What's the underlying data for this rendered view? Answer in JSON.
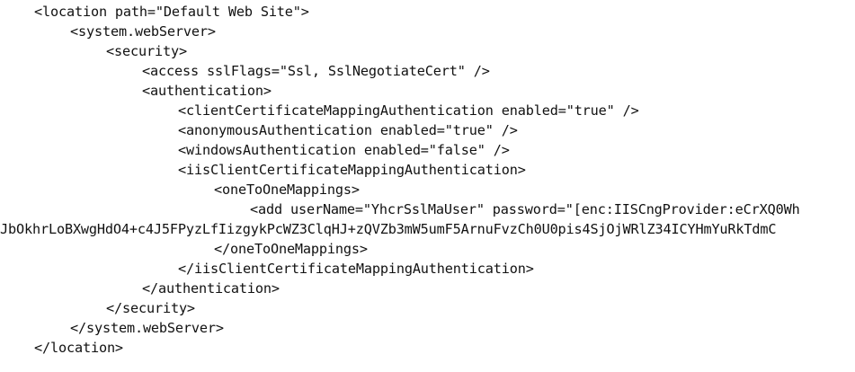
{
  "code": {
    "lines": [
      "<location path=\"Default Web Site\">",
      "<system.webServer>",
      "<security>",
      "<access sslFlags=\"Ssl, SslNegotiateCert\" />",
      "<authentication>",
      "<clientCertificateMappingAuthentication enabled=\"true\" />",
      "<anonymousAuthentication enabled=\"true\" />",
      "<windowsAuthentication enabled=\"false\" />",
      "<iisClientCertificateMappingAuthentication>",
      "<oneToOneMappings>",
      "<add userName=\"YhcrSslMaUser\" password=\"[enc:IISCngProvider:eCrXQ0Wh",
      "JbOkhrLoBXwgHdO4+c4J5FPyzLfIizgykPcWZ3ClqHJ+zQVZb3mW5umF5ArnuFvzCh0U0pis4SjOjWRlZ34ICYHmYuRkTdmC",
      "</oneToOneMappings>",
      "</iisClientCertificateMappingAuthentication>",
      "</authentication>",
      "</security>",
      "</system.webServer>",
      "</location>"
    ]
  }
}
